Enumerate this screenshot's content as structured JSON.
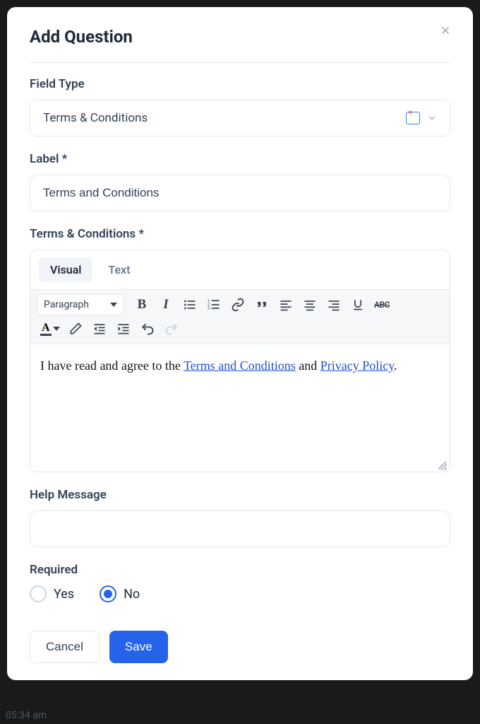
{
  "modal": {
    "title": "Add Question",
    "fieldType": {
      "label": "Field Type",
      "value": "Terms & Conditions"
    },
    "labelField": {
      "label": "Label *",
      "value": "Terms and Conditions"
    },
    "terms": {
      "label": "Terms & Conditions *",
      "tabs": {
        "visual": "Visual",
        "text": "Text",
        "active": "visual"
      },
      "blockFormat": "Paragraph",
      "content_prefix": "I have read and agree to the ",
      "content_link1": "Terms and Conditions",
      "content_mid": " and ",
      "content_link2": "Privacy Policy",
      "content_suffix": "."
    },
    "helpMessage": {
      "label": "Help Message",
      "value": ""
    },
    "required": {
      "label": "Required",
      "options": {
        "yes": "Yes",
        "no": "No"
      },
      "selected": "no"
    },
    "buttons": {
      "cancel": "Cancel",
      "save": "Save"
    }
  },
  "background_time": "05:34 am"
}
